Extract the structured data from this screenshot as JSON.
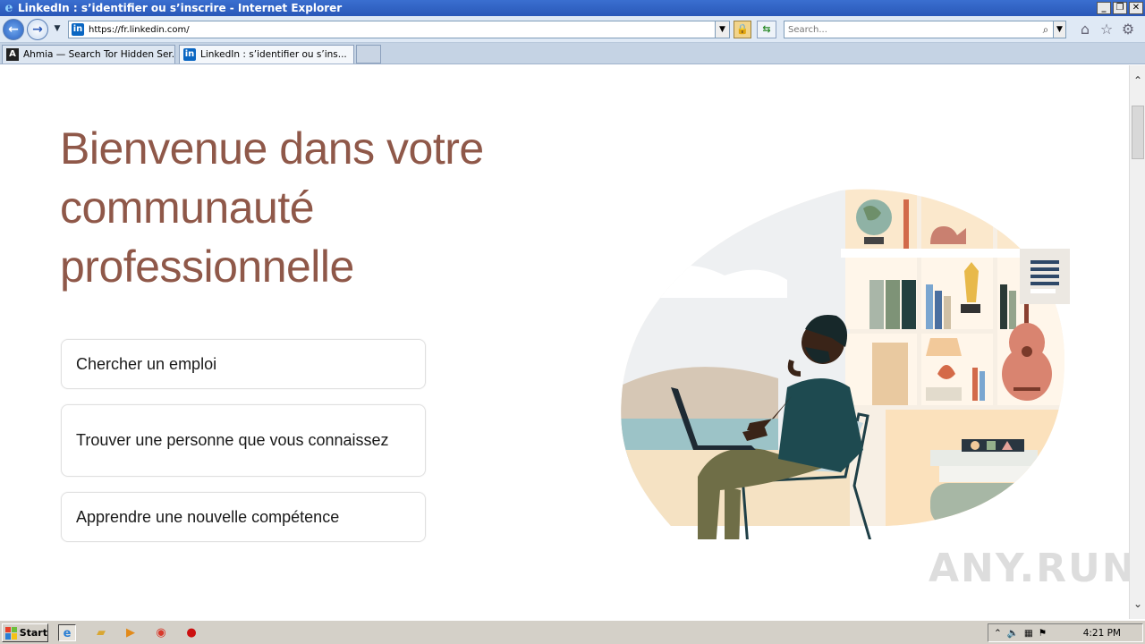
{
  "window": {
    "title": "LinkedIn : s’identifier ou s’inscrire - Internet Explorer"
  },
  "address_bar": {
    "url": "https://fr.linkedin.com/"
  },
  "search": {
    "placeholder": "Search..."
  },
  "tabs": [
    {
      "label": "Ahmia — Search Tor Hidden Ser...",
      "active": false
    },
    {
      "label": "LinkedIn : s’identifier ou s’ins...",
      "active": true
    }
  ],
  "page": {
    "headline": "Bienvenue dans votre communauté professionnelle",
    "options": [
      {
        "label": "Chercher un emploi"
      },
      {
        "label": "Trouver une personne que vous connaissez"
      },
      {
        "label": "Apprendre une nouvelle compétence"
      }
    ]
  },
  "watermark": "ANY.RUN",
  "taskbar": {
    "start_label": "Start",
    "clock": "4:21 PM"
  },
  "colors": {
    "headline": "#8f5849",
    "linkedin_blue": "#0a66c2",
    "title_bar": "#2a58b8"
  }
}
